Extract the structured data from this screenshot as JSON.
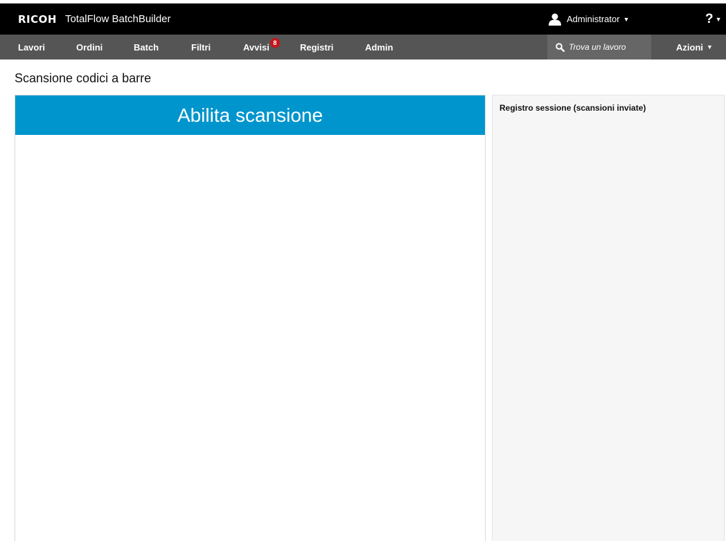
{
  "header": {
    "logo": "RICOH",
    "product": "TotalFlow BatchBuilder",
    "user": "Administrator",
    "help": "?"
  },
  "nav": {
    "items": [
      {
        "label": "Lavori"
      },
      {
        "label": "Ordini"
      },
      {
        "label": "Batch"
      },
      {
        "label": "Filtri"
      },
      {
        "label": "Avvisi",
        "badge": "8"
      },
      {
        "label": "Registri"
      },
      {
        "label": "Admin"
      }
    ],
    "search_placeholder": "Trova un lavoro",
    "actions": "Azioni"
  },
  "page": {
    "title": "Scansione codici a barre",
    "scan_button": "Abilita scansione",
    "log_title": "Registro sessione (scansioni inviate)"
  },
  "colors": {
    "accent": "#0095cc",
    "badge": "#c4161c",
    "navbar": "#555555",
    "topbar": "#000000"
  },
  "icons": {
    "user": "user-icon",
    "search": "search-icon",
    "caret": "caret-down-icon"
  }
}
